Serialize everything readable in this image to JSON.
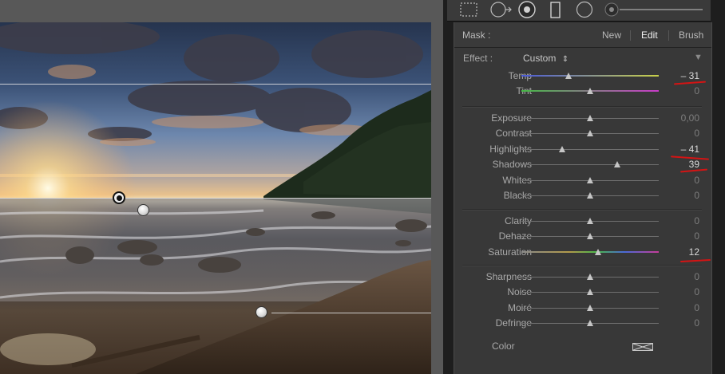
{
  "mask": {
    "label": "Mask :",
    "new_label": "New",
    "edit_label": "Edit",
    "brush_label": "Brush"
  },
  "effect": {
    "label": "Effect :",
    "preset": "Custom",
    "preset_arrow": "⇕",
    "collapse_glyph": "▼"
  },
  "groups": [
    {
      "rows": [
        {
          "label": "Temp",
          "value": "– 31",
          "slider": -31,
          "track": "temp",
          "changed": true
        },
        {
          "label": "Tint",
          "value": "0",
          "slider": 0,
          "track": "tint",
          "changed": false
        }
      ]
    },
    {
      "rows": [
        {
          "label": "Exposure",
          "value": "0,00",
          "slider": 0,
          "track": "gray",
          "changed": false
        },
        {
          "label": "Contrast",
          "value": "0",
          "slider": 0,
          "track": "gray",
          "changed": false
        },
        {
          "label": "Highlights",
          "value": "– 41",
          "slider": -41,
          "track": "gray",
          "changed": true
        },
        {
          "label": "Shadows",
          "value": "39",
          "slider": 39,
          "track": "gray",
          "changed": true
        },
        {
          "label": "Whites",
          "value": "0",
          "slider": 0,
          "track": "gray",
          "changed": false
        },
        {
          "label": "Blacks",
          "value": "0",
          "slider": 0,
          "track": "gray",
          "changed": false
        }
      ]
    },
    {
      "rows": [
        {
          "label": "Clarity",
          "value": "0",
          "slider": 0,
          "track": "gray",
          "changed": false
        },
        {
          "label": "Dehaze",
          "value": "0",
          "slider": 0,
          "track": "gray",
          "changed": false
        },
        {
          "label": "Saturation",
          "value": "12",
          "slider": 12,
          "track": "sat",
          "changed": true
        }
      ]
    },
    {
      "rows": [
        {
          "label": "Sharpness",
          "value": "0",
          "slider": 0,
          "track": "gray",
          "changed": false
        },
        {
          "label": "Noise",
          "value": "0",
          "slider": 0,
          "track": "gray",
          "changed": false
        },
        {
          "label": "Moiré",
          "value": "0",
          "slider": 0,
          "track": "gray",
          "changed": false
        },
        {
          "label": "Defringe",
          "value": "0",
          "slider": 0,
          "track": "gray",
          "changed": false
        }
      ]
    }
  ],
  "color": {
    "label": "Color",
    "swatch_icon": "color-swatch-empty-icon"
  },
  "tools": [
    "crop-overlay-icon",
    "spot-removal-icon",
    "red-eye-icon",
    "graduated-filter-icon",
    "radial-filter-icon",
    "adjustment-brush-icon"
  ],
  "colors": {
    "panel_bg": "#383838",
    "annotation_red": "#d41414",
    "text_label": "#a9a9a9",
    "text_value": "#7d7d7d"
  }
}
